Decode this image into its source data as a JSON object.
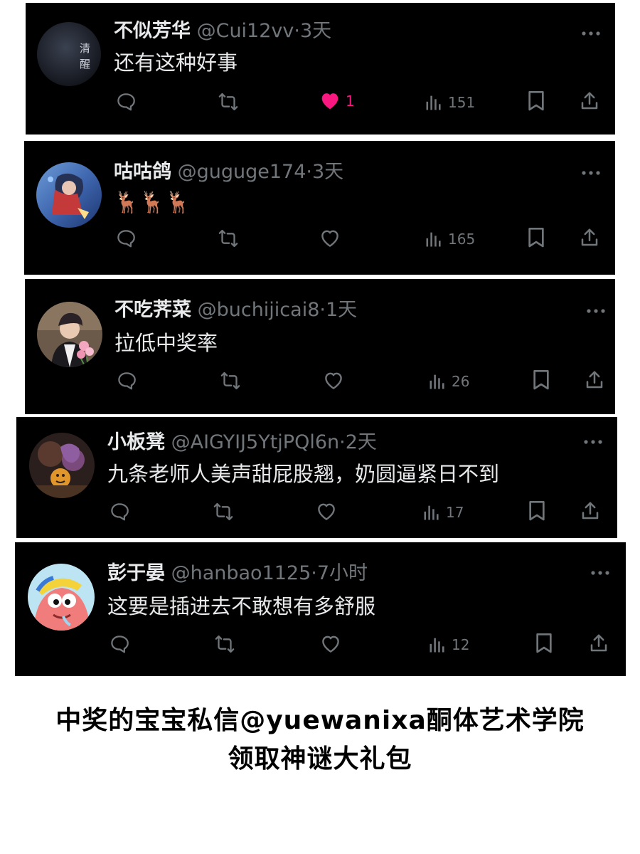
{
  "colors": {
    "background": "#000000",
    "text": "#e7e9ea",
    "muted": "#71767b",
    "like": "#f91880",
    "page": "#ffffff"
  },
  "posts": [
    {
      "name": "不似芳华",
      "handle": "@Cui12vv",
      "separator": "·",
      "time": "3天",
      "content": "还有这种好事",
      "liked": true,
      "likes": "1",
      "views": "151",
      "avatar_text": [
        "清",
        "醒"
      ]
    },
    {
      "name": "咕咕鸽",
      "handle": "@guguge174",
      "separator": "·",
      "time": "3天",
      "content": "🦌🦌🦌",
      "liked": false,
      "likes": "",
      "views": "165"
    },
    {
      "name": "不吃荠菜",
      "handle": "@buchijicai8",
      "separator": "·",
      "time": "1天",
      "content": "拉低中奖率",
      "liked": false,
      "likes": "",
      "views": "26"
    },
    {
      "name": "小板凳",
      "handle": "@AIGYIJ5YtjPQl6n",
      "separator": "·",
      "time": "2天",
      "content": "九条老师人美声甜屁股翘，奶圆逼紧日不到",
      "liked": false,
      "likes": "",
      "views": "17"
    },
    {
      "name": "彭于晏",
      "handle": "@hanbao1125",
      "separator": "·",
      "time": "7小时",
      "content": "这要是插进去不敢想有多舒服",
      "liked": false,
      "likes": "",
      "views": "12"
    }
  ],
  "icons": {
    "reply": "reply-icon",
    "repost": "repost-icon",
    "like": "heart-icon",
    "views": "views-chart-icon",
    "bookmark": "bookmark-icon",
    "share": "share-icon",
    "more": "more-dots-icon"
  },
  "footer": {
    "line1": "中奖的宝宝私信@yuewanixa酮体艺术学院",
    "line2": "领取神谜大礼包"
  }
}
